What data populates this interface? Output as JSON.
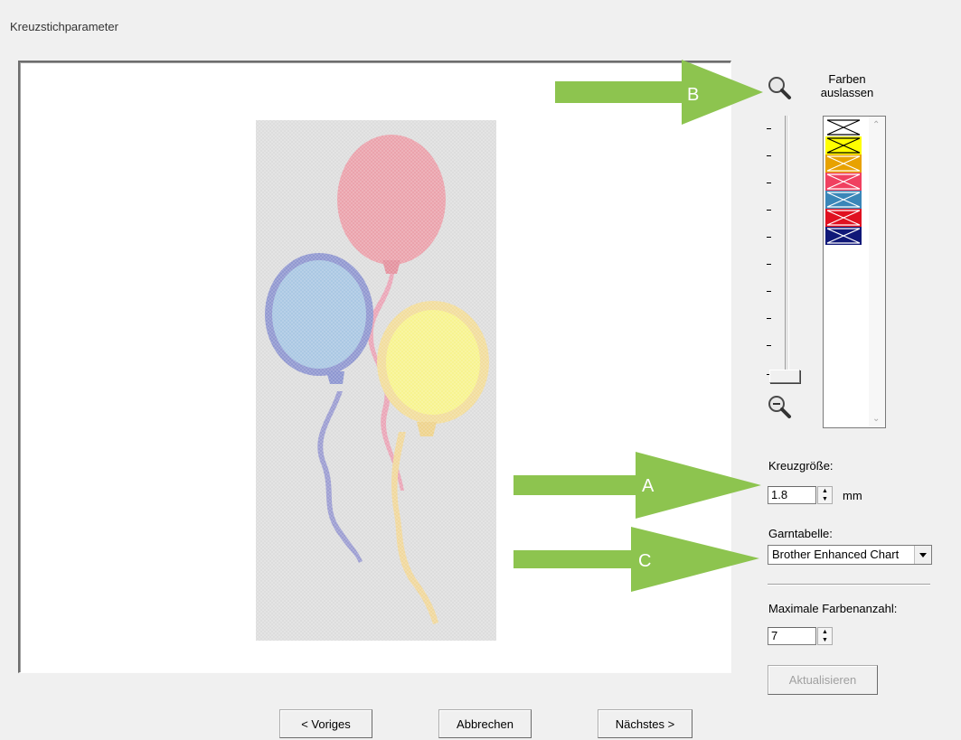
{
  "window": {
    "title": "Kreuzstichparameter"
  },
  "palette": {
    "label": "Farben auslassen",
    "swatches": [
      "#ffffff",
      "#ffff00",
      "#e8a200",
      "#f04060",
      "#3a86b8",
      "#e01020",
      "#101878"
    ]
  },
  "cross_size": {
    "label": "Kreuzgröße:",
    "value": "1.8",
    "unit": "mm"
  },
  "thread_chart": {
    "label": "Garntabelle:",
    "selected": "Brother Enhanced Chart"
  },
  "max_colors": {
    "label": "Maximale Farbenanzahl:",
    "value": "7"
  },
  "update_button": "Aktualisieren",
  "footer": {
    "prev": "< Voriges",
    "cancel": "Abbrechen",
    "next": "Nächstes >"
  },
  "callouts": {
    "a": "A",
    "b": "B",
    "c": "C"
  },
  "colors": {
    "callout_green": "#8dc44f"
  },
  "icons": {
    "zoom_in": "zoom-in-icon",
    "zoom_out": "zoom-out-icon",
    "scroll_up": "chevron-up-icon",
    "scroll_down": "chevron-down-icon",
    "dropdown": "chevron-down-icon"
  }
}
